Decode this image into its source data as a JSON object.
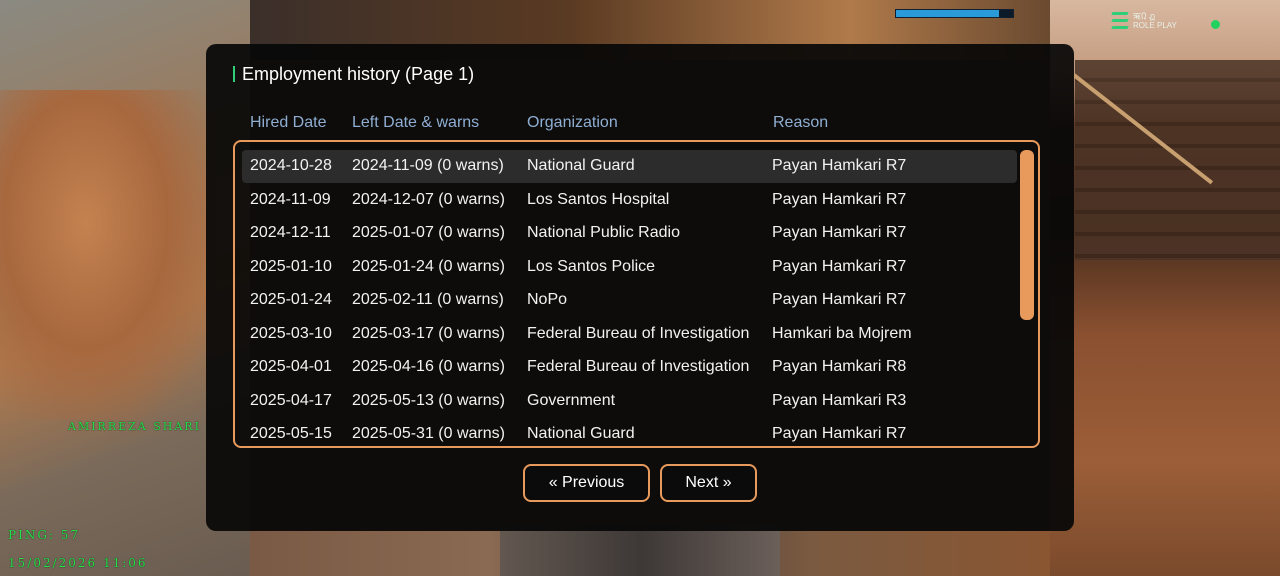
{
  "dialog": {
    "title": "Employment history (Page 1)",
    "columns": [
      "Hired Date",
      "Left Date & warns",
      "Organization",
      "Reason"
    ],
    "rows": [
      {
        "hired": "2024-10-28",
        "left": "2024-11-09 (0 warns)",
        "org": "National Guard",
        "reason": "Payan Hamkari R7"
      },
      {
        "hired": "2024-11-09",
        "left": "2024-12-07 (0 warns)",
        "org": "Los Santos Hospital",
        "reason": "Payan Hamkari R7"
      },
      {
        "hired": "2024-12-11",
        "left": "2025-01-07 (0 warns)",
        "org": "National Public Radio",
        "reason": "Payan Hamkari R7"
      },
      {
        "hired": "2025-01-10",
        "left": "2025-01-24 (0 warns)",
        "org": "Los Santos Police",
        "reason": "Payan Hamkari R7"
      },
      {
        "hired": "2025-01-24",
        "left": "2025-02-11 (0 warns)",
        "org": "NoPo",
        "reason": "Payan Hamkari R7"
      },
      {
        "hired": "2025-03-10",
        "left": "2025-03-17 (0 warns)",
        "org": "Federal Bureau of Investigation",
        "reason": "Hamkari ba Mojrem"
      },
      {
        "hired": "2025-04-01",
        "left": "2025-04-16 (0 warns)",
        "org": "Federal Bureau of Investigation",
        "reason": "Payan Hamkari R8"
      },
      {
        "hired": "2025-04-17",
        "left": "2025-05-13 (0 warns)",
        "org": "Government",
        "reason": "Payan Hamkari R3"
      },
      {
        "hired": "2025-05-15",
        "left": "2025-05-31 (0 warns)",
        "org": "National Guard",
        "reason": "Payan Hamkari R7"
      }
    ],
    "selected_row": 0,
    "prev_label": "« Previous",
    "next_label": "Next »"
  },
  "hud": {
    "logo_text": "ऋ᠒ ฏ",
    "logo_sub": "ROLE PLAY",
    "player_name": "AMIRREZA SHARI",
    "ping": "PING: 57",
    "datetime": "15/02/2026 11:06",
    "health_fraction": 0.88
  },
  "colors": {
    "accent_orange": "#e89a5c",
    "header_blue": "#8eaed3",
    "hud_green": "#27e04a",
    "health_blue": "#2a9ad8"
  }
}
